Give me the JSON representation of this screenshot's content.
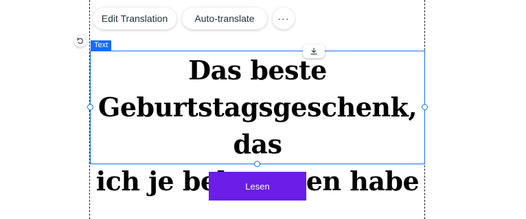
{
  "toolbar": {
    "edit_translation_label": "Edit Translation",
    "auto_translate_label": "Auto-translate",
    "more_label": "···"
  },
  "element": {
    "type_tag": "Text",
    "heading": "Das beste\nGeburtstagsgeschenk, das\nich je bekommen habe"
  },
  "cta": {
    "label": "Lesen"
  },
  "icons": {
    "reset": "undo-icon",
    "download": "download-icon",
    "more": "more-horizontal-icon"
  },
  "colors": {
    "selection": "#116dff",
    "button_bg": "#6a1ee8",
    "button_text": "#ffffff",
    "heading_text": "#000000",
    "guide": "#1a1a1a"
  }
}
